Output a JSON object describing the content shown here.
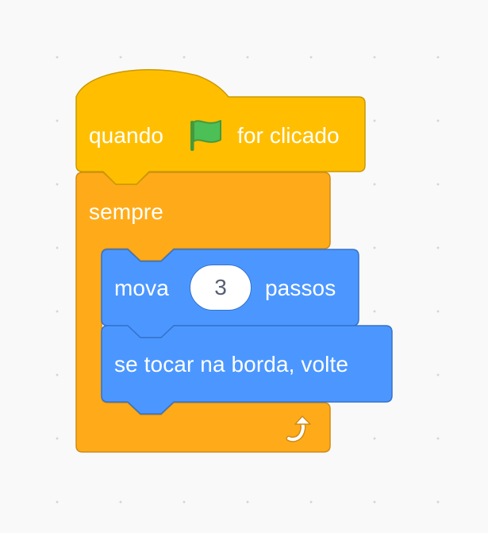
{
  "script": {
    "hat_block": {
      "text_before": "quando",
      "icon": "green-flag-icon",
      "text_after": "for clicado",
      "color": "#FFBF00",
      "border_color": "#CC9900"
    },
    "forever_block": {
      "label": "sempre",
      "icon": "loop-arrow-icon",
      "color": "#FFAB19",
      "border_color": "#CF8B17"
    },
    "move_block": {
      "text_before": "mova",
      "input_value": "3",
      "text_after": "passos",
      "color": "#4C97FF",
      "border_color": "#3373CC"
    },
    "bounce_block": {
      "label": "se tocar na borda, volte",
      "color": "#4C97FF",
      "border_color": "#3373CC"
    }
  }
}
